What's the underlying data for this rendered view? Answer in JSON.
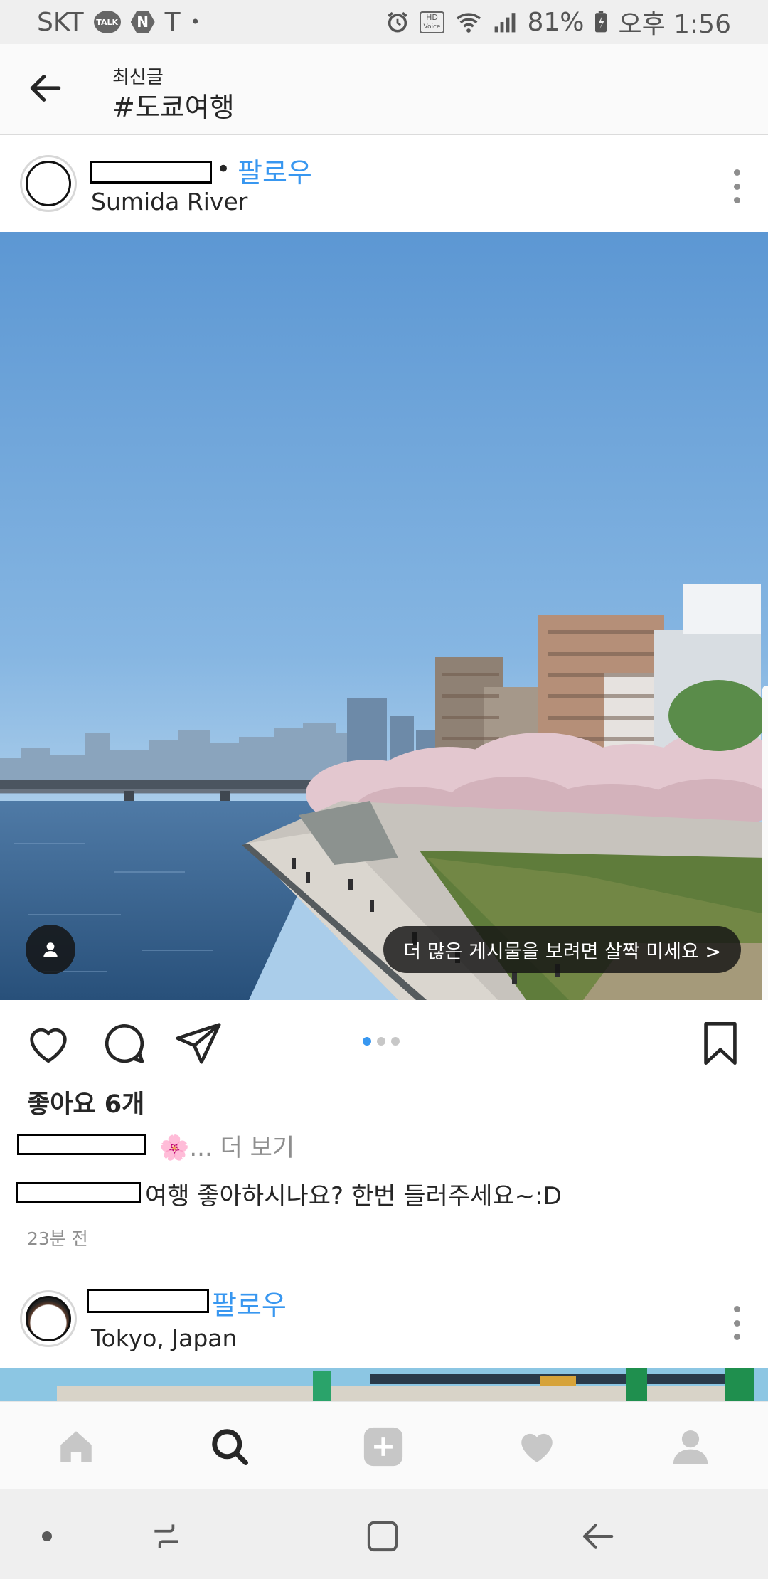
{
  "status_bar": {
    "carrier": "SKT",
    "talk_icon_label": "TALK",
    "naver_icon_label": "N",
    "carrier_icon": "T",
    "notification_dot": "•",
    "hd_label_top": "HD",
    "hd_label_bottom": "Voice",
    "battery": "81%",
    "time": "오후 1:56"
  },
  "header": {
    "subtitle": "최신글",
    "title": "#도쿄여행"
  },
  "post1": {
    "separator": "•",
    "follow_label": "팔로우",
    "location": "Sumida River",
    "hint_text": "더 많은 게시물을 보려면 살짝 미세요 >",
    "likes": "좋아요 6개",
    "caption_preview": "🌸... 더 보기",
    "comment_text": "여행 좋아하시나요? 한번 들러주세요~:D",
    "time_ago": "23분 전",
    "carousel": {
      "count": 3,
      "active": 0
    }
  },
  "post2": {
    "follow_label": "팔로우",
    "location": "Tokyo, Japan"
  },
  "colors": {
    "accent": "#3897f0",
    "text": "#262626",
    "muted": "#8e8e8e"
  },
  "icons": {
    "back": "arrow-left-icon",
    "like": "heart-outline-icon",
    "comment": "speech-bubble-icon",
    "share": "paper-plane-icon",
    "save": "bookmark-icon",
    "home": "home-icon",
    "search": "search-icon",
    "add": "plus-square-icon",
    "activity": "heart-filled-icon",
    "profile": "person-icon"
  }
}
